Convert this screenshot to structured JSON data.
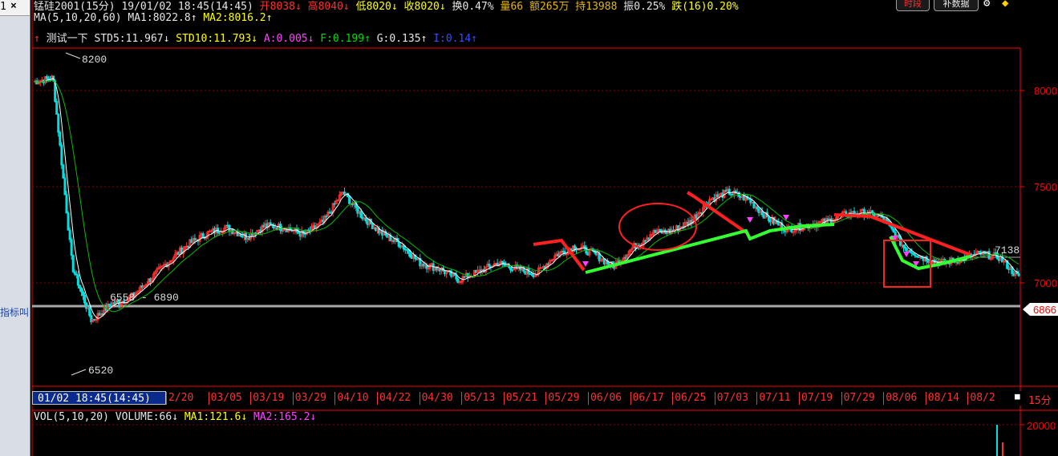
{
  "left_panel": {
    "tab_number": "1",
    "close_glyph": "×",
    "side_label": "指标叫"
  },
  "header": {
    "symbol_info": "锰硅2001(15分) 19/01/02 18:45(14:45)",
    "open": "开8038",
    "high": "高8040",
    "low": "低8020",
    "close": "收8020",
    "turnover": "换0.47%",
    "volume": "量66",
    "amount": "额265万",
    "open_interest": "持13988",
    "amplitude": "振0.25%",
    "change": "跌(16)0.20%",
    "buttons": [
      "时段",
      "补数据"
    ],
    "icons": [
      "gear-icon",
      "diamond-icon"
    ]
  },
  "ma_line": {
    "label": "MA(5,10,20,60)",
    "ma1": "MA1:8022.8",
    "ma2": "MA2:8016.2"
  },
  "indicator_line": {
    "name": "测试一下",
    "std5": "STD5:11.967",
    "std10": "STD10:11.793",
    "a": "A:0.005",
    "f": "F:0.199",
    "g": "G:0.135",
    "i": "I:0.14"
  },
  "chart": {
    "max_label": "8200",
    "min_label": "6520",
    "range_label": "6558 - 6890",
    "y_axis": [
      "8000",
      "7500",
      "7000"
    ],
    "current_price_tag": "6866",
    "right_level_label": "7138",
    "x_axis_labels": [
      "01/02 18:45(14:45)",
      "2/20",
      "03/05",
      "03/19",
      "03/29",
      "04/10",
      "04/22",
      "04/30",
      "05/13",
      "05/21",
      "05/29",
      "06/06",
      "06/17",
      "06/25",
      "07/03",
      "07/11",
      "07/19",
      "07/29",
      "08/06",
      "08/14",
      "08/2"
    ],
    "period_label": "15分"
  },
  "volume_panel": {
    "label": "VOL(5,10,20)",
    "volume": "VOLUME:66",
    "ma1": "MA1:121.6",
    "ma2": "MA2:165.2",
    "y_axis_top": "20000"
  },
  "colors": {
    "background": "#000000",
    "up": "#ff3030",
    "down": "#00e0e0",
    "grid": "#8b0000",
    "axis": "#ff0000",
    "ma1": "#ffffff",
    "ma2": "#00c000",
    "highlight_box": "#ff2020",
    "trend_green": "#33ff33"
  },
  "chart_data": {
    "type": "line",
    "series": [
      {
        "values": [
          8050,
          8070,
          7060,
          6770,
          6860,
          6890,
          6990,
          7090,
          7180,
          7240,
          7270,
          7220,
          7280,
          7270,
          7230,
          7300,
          7460,
          7330,
          7240,
          7180,
          7080,
          7050,
          6990,
          7030,
          7080,
          7050,
          7020,
          7120,
          7170,
          7130,
          7060,
          7160,
          7240,
          7250,
          7300,
          7420,
          7460,
          7420,
          7320,
          7260,
          7280,
          7300,
          7340,
          7350,
          7320,
          7170,
          7110,
          7080,
          7100,
          7130,
          7110,
          7000
        ]
      }
    ],
    "ylim": [
      6420,
      8230
    ],
    "annotations": [
      "8200",
      "6520",
      "6558 - 6890",
      "7138",
      "6866"
    ]
  }
}
